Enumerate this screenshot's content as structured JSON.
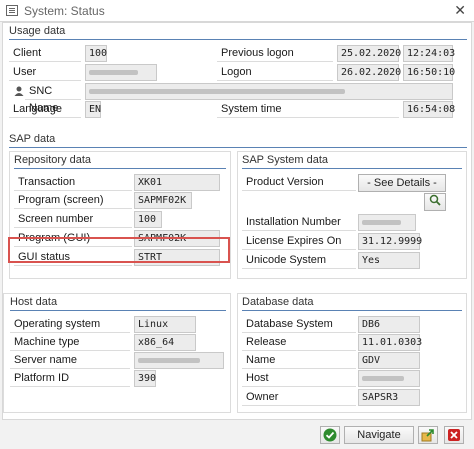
{
  "window": {
    "title": "System: Status",
    "close_glyph": "✕"
  },
  "usage": {
    "title": "Usage data",
    "client_label": "Client",
    "client_value": "100",
    "user_label": "User",
    "user_value": "██████",
    "snc_label": "SNC Name",
    "snc_value": "████████████████████████████",
    "language_label": "Language",
    "language_value": "EN",
    "prev_logon_label": "Previous logon",
    "prev_logon_date": "25.02.2020",
    "prev_logon_time": "12:24:03",
    "logon_label": "Logon",
    "logon_date": "26.02.2020",
    "logon_time": "16:50:10",
    "systime_label": "System time",
    "systime_value": "16:54:08"
  },
  "sap": {
    "title": "SAP data",
    "repo": {
      "title": "Repository data",
      "transaction_label": "Transaction",
      "transaction_value": "XK01",
      "program_screen_label": "Program (screen)",
      "program_screen_value": "SAPMF02K",
      "screen_number_label": "Screen number",
      "screen_number_value": "100",
      "program_gui_label": "Program (GUI)",
      "program_gui_value": "SAPMF02K",
      "gui_status_label": "GUI status",
      "gui_status_value": "STRT"
    },
    "system": {
      "title": "SAP System data",
      "product_version_label": "Product Version",
      "product_version_value": "- See Details -",
      "installation_number_label": "Installation Number",
      "installation_number_value": "██████",
      "license_label": "License Expires On",
      "license_value": "31.12.9999",
      "unicode_label": "Unicode System",
      "unicode_value": "Yes"
    }
  },
  "host": {
    "title": "Host data",
    "os_label": "Operating system",
    "os_value": "Linux",
    "machine_label": "Machine type",
    "machine_value": "x86_64",
    "server_label": "Server name",
    "server_value": "████████",
    "platform_label": "Platform ID",
    "platform_value": "390"
  },
  "database": {
    "title": "Database data",
    "dbsys_label": "Database System",
    "dbsys_value": "DB6",
    "release_label": "Release",
    "release_value": "11.01.0303",
    "name_label": "Name",
    "name_value": "GDV",
    "host_label": "Host",
    "host_value": "██████",
    "owner_label": "Owner",
    "owner_value": "SAPSR3"
  },
  "footer": {
    "navigate_label": "Navigate"
  },
  "colors": {
    "group_line": "#5a82b4",
    "highlight": "#d9534f",
    "ok_green": "#2e8b2e",
    "cancel_red": "#cc2222"
  }
}
